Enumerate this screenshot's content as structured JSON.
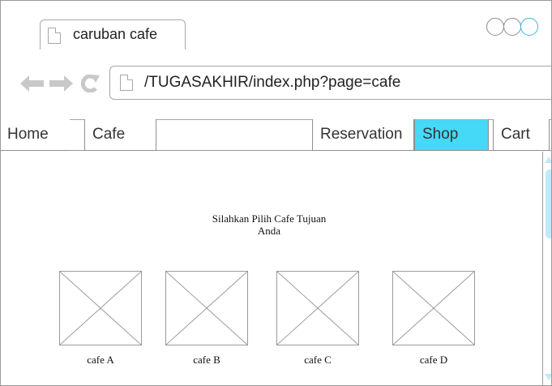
{
  "browser": {
    "tab_title": "caruban cafe",
    "address": "/TUGASAKHIR/index.php?page=cafe",
    "icons": [
      "back-arrow-icon",
      "forward-arrow-icon",
      "reload-icon",
      "page-icon"
    ]
  },
  "nav": {
    "home": "Home",
    "cafe": "Cafe",
    "reservation": "Reservation",
    "shop": "Shop",
    "cart": "Cart",
    "active": "Shop"
  },
  "content": {
    "headline_line1": "Silahkan Pilih Cafe Tujuan",
    "headline_line2": "Anda",
    "cafes": [
      {
        "label": "cafe A"
      },
      {
        "label": "cafe B"
      },
      {
        "label": "cafe C"
      },
      {
        "label": "cafe D"
      }
    ]
  },
  "colors": {
    "active_tab": "#46d8f7",
    "border": "#9a9a9a",
    "maximize_button": "#38b7e8",
    "scroll": "#bfeafb"
  }
}
